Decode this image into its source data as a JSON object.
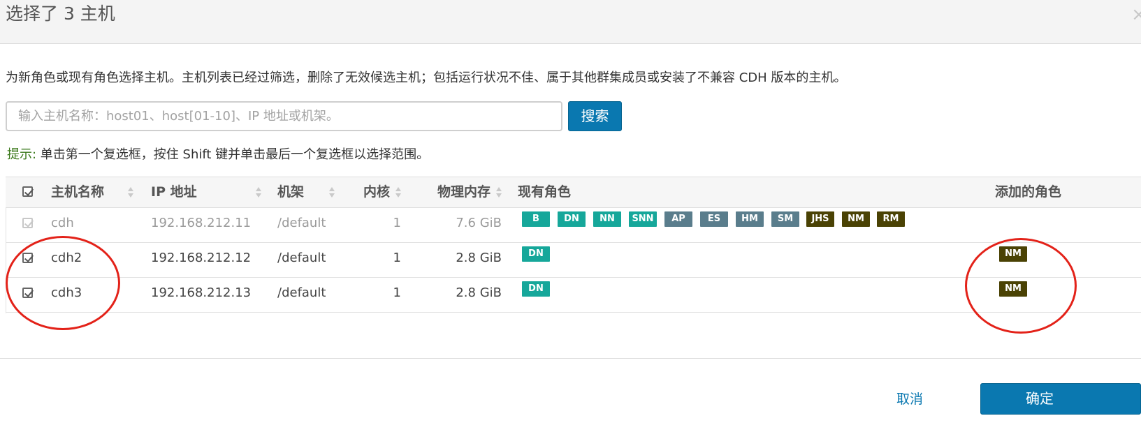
{
  "modal": {
    "title": "选择了 3 主机",
    "close_label": "×"
  },
  "description": "为新角色或现有角色选择主机。主机列表已经过筛选，删除了无效候选主机；包括运行状况不佳、属于其他群集成员或安装了不兼容 CDH 版本的主机。",
  "search": {
    "placeholder": "输入主机名称：host01、host[01-10]、IP 地址或机架。",
    "value": "",
    "button_label": "搜索"
  },
  "hint": {
    "label": "提示:",
    "text": " 单击第一个复选框，按住 Shift 键并单击最后一个复选框以选择范围。"
  },
  "table": {
    "select_all_checked": true,
    "columns": {
      "hostname": "主机名称",
      "ip": "IP 地址",
      "rack": "机架",
      "cores": "内核",
      "memory": "物理内存",
      "existing_roles": "现有角色",
      "added_roles": "添加的角色"
    },
    "rows": [
      {
        "checked": true,
        "disabled": true,
        "hostname": "cdh",
        "ip": "192.168.212.11",
        "rack": "/default",
        "cores": "1",
        "memory": "7.6 GiB",
        "existing_roles": [
          "B",
          "DN",
          "NN",
          "SNN",
          "AP",
          "ES",
          "HM",
          "SM",
          "JHS",
          "NM",
          "RM"
        ],
        "added_roles": []
      },
      {
        "checked": true,
        "disabled": false,
        "hostname": "cdh2",
        "ip": "192.168.212.12",
        "rack": "/default",
        "cores": "1",
        "memory": "2.8 GiB",
        "existing_roles": [
          "DN"
        ],
        "added_roles": [
          "NM"
        ]
      },
      {
        "checked": true,
        "disabled": false,
        "hostname": "cdh3",
        "ip": "192.168.212.13",
        "rack": "/default",
        "cores": "1",
        "memory": "2.8 GiB",
        "existing_roles": [
          "DN"
        ],
        "added_roles": [
          "NM"
        ]
      }
    ]
  },
  "role_colors": {
    "B": "#16a79a",
    "DN": "#16a79a",
    "NN": "#16a79a",
    "SNN": "#16a79a",
    "AP": "#5a7d8c",
    "ES": "#5a7d8c",
    "HM": "#5a7d8c",
    "SM": "#5a7d8c",
    "JHS": "#4a4204",
    "NM": "#4a4204",
    "RM": "#4a4204"
  },
  "annotation_color": "#e32219",
  "footer": {
    "cancel_label": "取消",
    "confirm_label": "确定"
  }
}
